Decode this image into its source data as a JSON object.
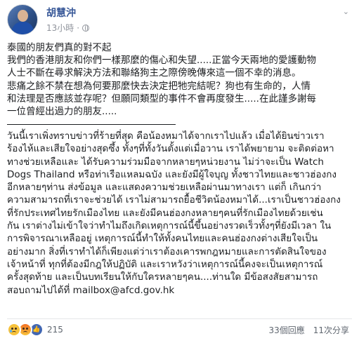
{
  "post": {
    "author": "胡慧沖",
    "time": "13小時",
    "visibility_icon": "globe-icon",
    "text_zh": [
      "泰國的朋友們真的對不起",
      "我們的香港朋友和你們一樣那麼的傷心和失望.....正當今天兩地的愛護動物",
      "人士不斷在尋求解決方法和聯絡狗主之際傍晚傳來這一個不幸的消息。",
      "悲痛之餘不禁在想為何要那麼快去決定把牠完結呢？狗也有生命的，人情",
      "和法理是否應該並存呢？但願同類型的事件不會再度發生.....在此謹多謝每",
      "一位曾經出過力的朋友....."
    ],
    "text_th": [
      "วันนี้เราเพิ่งทราบข่าวที่ร้ายที่สุด คือน้องหมาได้จากเราไปแล้ว เมื่อได้ยินข่าวเรา",
      "ร้องไห้และเสียใจอย่างสุดซึ้ง ทั้งๆที่ทั้งวันตั้งแต่เมื่อวาน เราได้พยายาม จะติดต่อหา",
      "ทางช่วยเหลือและ ได้รับความร่วมมือจากหลายๆหน่วยงาน ไม่ว่าจะเป็น Watch",
      "Dogs Thailand หรือท่าเรือแหลมฉบัง และยังมีผู้ใจบุญ ทั้งชาวไทยและชาวฮ่องกง",
      "อีกหลายๆท่าน ส่งข้อมูล และแสดงความช่วยเหลือผ่านมาทางเรา แต่ก็ เกินกว่า",
      "ความสามารถที่เราจะช่วยได้ เราไม่สามารถยื้อชีวิตน้องหมาได้...เราเป็นชาวฮ่องกง",
      "ที่รักประเทศไทยรักเมืองไทย และยังมีคนฮ่องกงหลายๆคนที่รักเมืองไทยด้วยเช่น",
      "กัน เราต่างไม่เข้าใจว่าทำไมถึงเกิดเหตุการณ์นี้ขึ้นอย่างรวดเร็วทั้งๆที่ยังมีเวลา ใน",
      "การพิจารณาเหลืออยู่ เหตุการณ์นี้ทำให้ทั้งคนไทยและคนฮ่องกงต่างเสียใจเป็น",
      "อย่างมาก สิ่งที่เราทำได้ก็เพียงแต่ว่าเราต้องเคารพกฎหมายและการตัดสินใจของ",
      "เจ้าหน้าที่ ทุกที่ต้องมีกฎให้ปฏิบัติ และเราหวังว่าเหตุการณ์นี้คงจะเป็นเหตุการณ์",
      "ครั้งสุดท้าย และเป็นบทเรียนให้กับใครหลายๆคน....ท่านใด มีข้อสงสัยสามารถ",
      "สอบถามไปได้ที่ mailbox@afcd.gov.hk"
    ],
    "reactions": {
      "icons": [
        "sad-reaction-icon",
        "angry-reaction-icon",
        "like-reaction-icon"
      ],
      "count": "215"
    },
    "comments": "33個回應",
    "shares": "11次分享"
  }
}
